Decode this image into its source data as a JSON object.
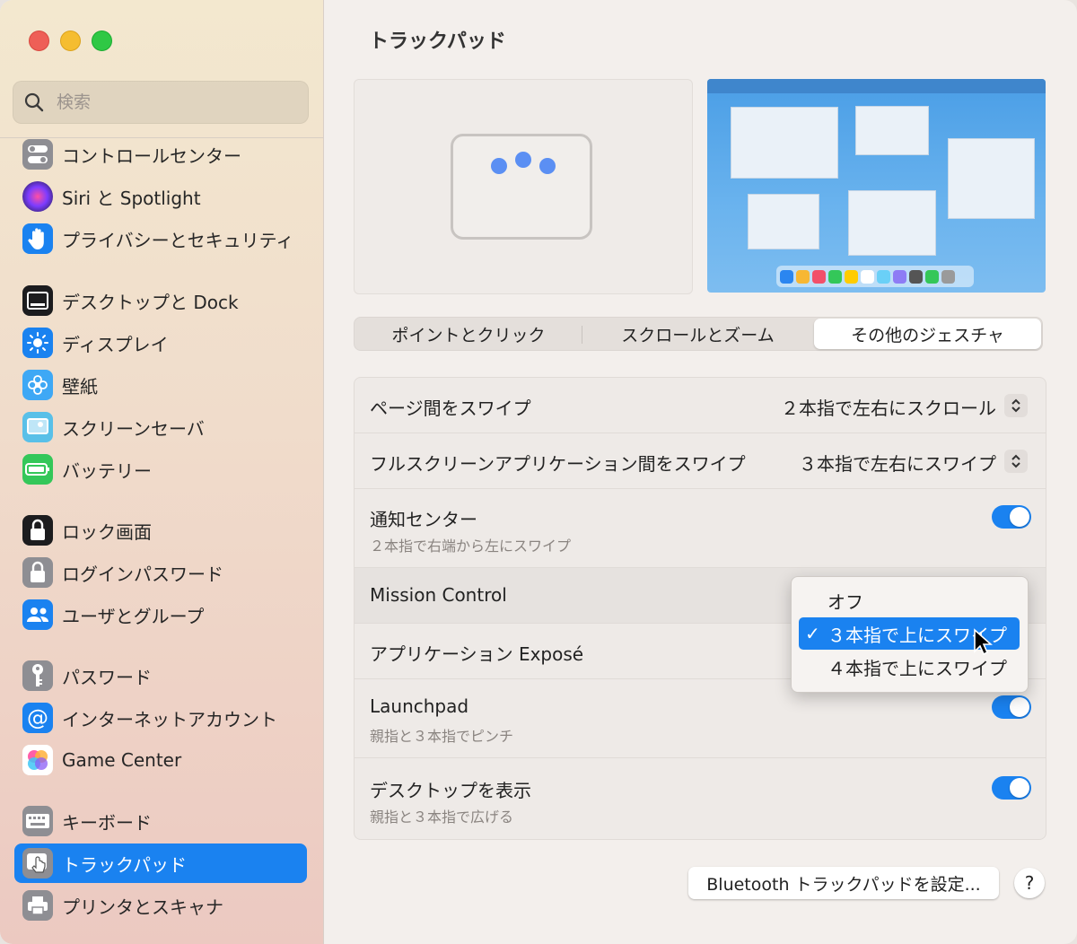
{
  "search": {
    "placeholder": "検索"
  },
  "sidebar": {
    "items": [
      {
        "label": "コントロールセンター",
        "icon": "control-center-icon"
      },
      {
        "label": "Siri と Spotlight",
        "icon": "siri-icon"
      },
      {
        "label": "プライバシーとセキュリティ",
        "icon": "hand-icon"
      },
      {
        "label": "デスクトップと Dock",
        "icon": "desktop-dock-icon"
      },
      {
        "label": "ディスプレイ",
        "icon": "sun-icon"
      },
      {
        "label": "壁紙",
        "icon": "flower-icon"
      },
      {
        "label": "スクリーンセーバ",
        "icon": "screensaver-icon"
      },
      {
        "label": "バッテリー",
        "icon": "battery-icon"
      },
      {
        "label": "ロック画面",
        "icon": "lock-icon"
      },
      {
        "label": "ログインパスワード",
        "icon": "lock-icon"
      },
      {
        "label": "ユーザとグループ",
        "icon": "users-icon"
      },
      {
        "label": "パスワード",
        "icon": "key-icon"
      },
      {
        "label": "インターネットアカウント",
        "icon": "at-icon"
      },
      {
        "label": "Game Center",
        "icon": "game-center-icon"
      },
      {
        "label": "キーボード",
        "icon": "keyboard-icon"
      },
      {
        "label": "トラックパッド",
        "icon": "trackpad-icon",
        "selected": true
      },
      {
        "label": "プリンタとスキャナ",
        "icon": "printer-icon"
      }
    ]
  },
  "main": {
    "title": "トラックパッド",
    "tabs": [
      {
        "label": "ポイントとクリック"
      },
      {
        "label": "スクロールとズーム"
      },
      {
        "label": "その他のジェスチャ",
        "active": true
      }
    ],
    "rows": [
      {
        "label": "ページ間をスワイプ",
        "value": "２本指で左右にスクロール"
      },
      {
        "label": "フルスクリーンアプリケーション間をスワイプ",
        "value": "３本指で左右にスワイプ"
      },
      {
        "label": "通知センター",
        "sub": "２本指で右端から左にスワイプ",
        "on": true
      },
      {
        "label": "Mission Control"
      },
      {
        "label": "アプリケーション Exposé"
      },
      {
        "label": "Launchpad",
        "sub": "親指と３本指でピンチ",
        "on": true
      },
      {
        "label": "デスクトップを表示",
        "sub": "親指と３本指で広げる",
        "on": true
      }
    ],
    "popup": {
      "options": [
        {
          "label": "オフ"
        },
        {
          "label": "３本指で上にスワイプ",
          "selected": true
        },
        {
          "label": "４本指で上にスワイプ"
        }
      ],
      "check": "✓"
    },
    "bluetooth_button": "Bluetooth トラックパッドを設定...",
    "help_button": "?"
  },
  "colors": {
    "accent": "#1a82f0",
    "close": "#ee5f57",
    "minimize": "#f5bd30",
    "zoom": "#2fc845"
  }
}
